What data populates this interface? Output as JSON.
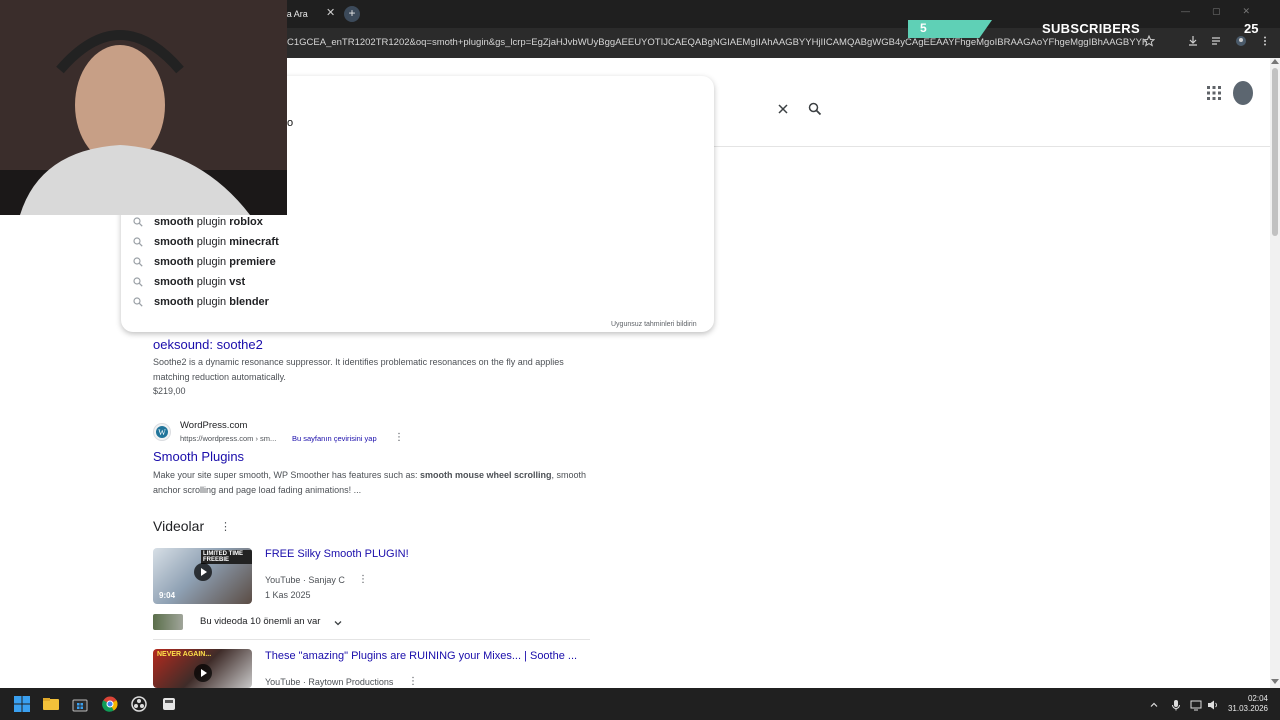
{
  "browser": {
    "tab_title": "'da Ara",
    "tab_close": "✕",
    "newtab_label": "+",
    "url": "C1GCEA_enTR1202TR1202&oq=smoth+plugin&gs_lcrp=EgZjaHJvbWUyBggAEEUYOTIJCAEQABgNGIAEMgIIAhAAGBYYHjIICAMQABgWGB4yCAgEEAAYFhgeMgoIBRAAGAoYFhgeMggIBhAAGBYYHjIICAcQABg..."
  },
  "overlay": {
    "subs_count_small": "5",
    "subs_label": "SUBSCRIBERS",
    "subs_count": "25"
  },
  "search": {
    "partial_text": "o",
    "suggestions": [
      {
        "bold_prefix": "smooth",
        "normal": " plugin ",
        "bold_suffix": "roblox"
      },
      {
        "bold_prefix": "smooth",
        "normal": " plugin ",
        "bold_suffix": "minecraft"
      },
      {
        "bold_prefix": "smooth",
        "normal": " plugin ",
        "bold_suffix": "premiere"
      },
      {
        "bold_prefix": "smooth",
        "normal": " plugin ",
        "bold_suffix": "vst"
      },
      {
        "bold_prefix": "smooth",
        "normal": " plugin ",
        "bold_suffix": "blender"
      }
    ],
    "report_label": "Uygunsuz tahminleri bildirin"
  },
  "results": {
    "r1": {
      "title": "oeksound: soothe2",
      "desc": "Soothe2 is a dynamic resonance suppressor. It identifies problematic resonances on the fly and applies matching reduction automatically.",
      "price": "$219,00"
    },
    "r2": {
      "site": "WordPress.com",
      "url": "https://wordpress.com › sm...",
      "translate": "Bu sayfanın çevirisini yap",
      "more": "⋮",
      "title": "Smooth Plugins",
      "desc_a": "Make your site super smooth, WP Smoother has features such as: ",
      "desc_b": "smooth mouse wheel scrolling",
      "desc_c": ", smooth anchor scrolling and page load fading animations! ..."
    }
  },
  "videos": {
    "heading": "Videolar",
    "more": "⋮",
    "v1": {
      "badge": "LIMITED TIME FREEBIE",
      "duration": "9:04",
      "title": "FREE Silky Smooth PLUGIN!",
      "source": "YouTube · Sanjay C",
      "more": "⋮",
      "date": "1 Kas 2025"
    },
    "key_moments": "Bu videoda 10 önemli an var",
    "v2": {
      "badge": "NEVER AGAIN...",
      "title": "These \"amazing\" Plugins are RUINING your Mixes... | Soothe ...",
      "source": "YouTube · Raytown Productions",
      "more": "⋮"
    }
  },
  "taskbar": {
    "time": "02:04",
    "date": "31.03.2026"
  }
}
